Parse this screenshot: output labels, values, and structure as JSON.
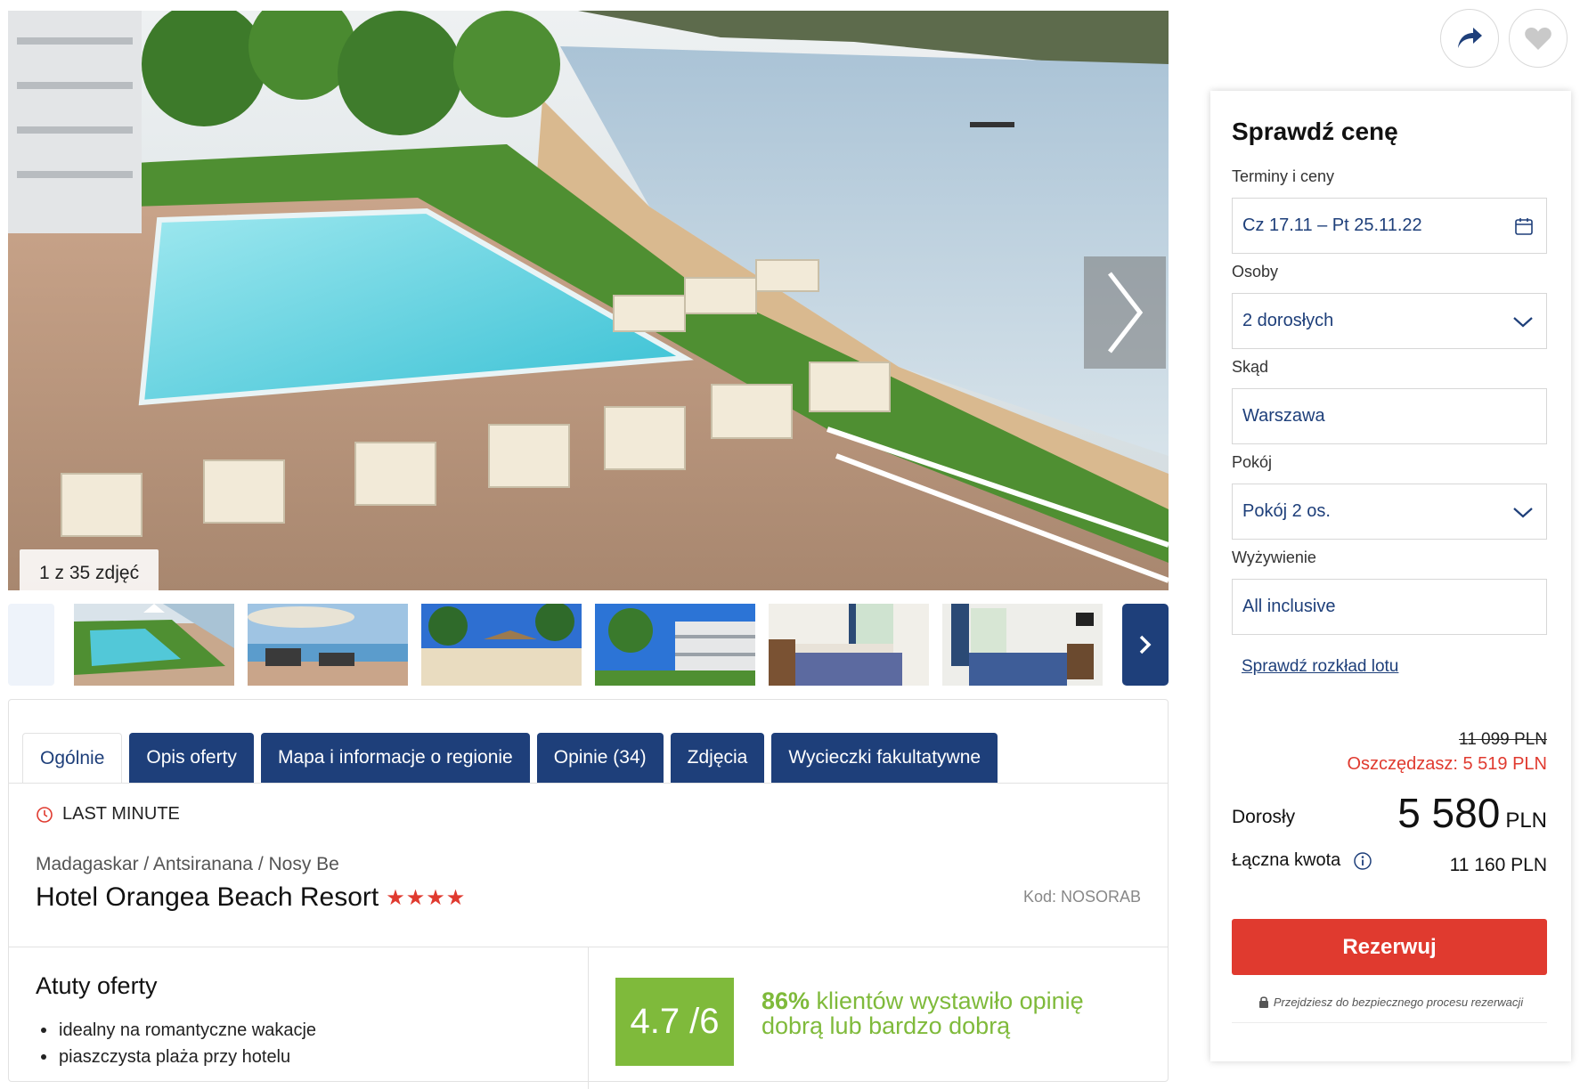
{
  "gallery": {
    "counter": "1 z 35 zdjęć",
    "next_icon": "chevron-right-icon",
    "thumbs_next_icon": "chevron-right-icon"
  },
  "tabs": [
    {
      "label": "Ogólnie",
      "active": true
    },
    {
      "label": "Opis oferty",
      "active": false
    },
    {
      "label": "Mapa i informacje o regionie",
      "active": false
    },
    {
      "label": "Opinie (34)",
      "active": false
    },
    {
      "label": "Zdjęcia",
      "active": false
    },
    {
      "label": "Wycieczki fakultatywne",
      "active": false
    }
  ],
  "offer": {
    "badge": "LAST MINUTE",
    "badge_icon": "clock-icon",
    "breadcrumb": "Madagaskar / Antsiranana / Nosy Be",
    "hotel_name": "Hotel Orangea Beach Resort",
    "stars": "★★★★",
    "star_count": 4,
    "code": "Kod: NOSORAB"
  },
  "perks": {
    "title": "Atuty oferty",
    "items": [
      "idealny na romantyczne wakacje",
      "piaszczysta plaża przy hotelu"
    ]
  },
  "rating": {
    "score": "4.7 /6",
    "percent": "86%",
    "text": " klientów wystawiło opinię dobrą lub bardzo dobrą"
  },
  "actions": {
    "share_icon": "share-arrow-icon",
    "favorite_icon": "heart-icon"
  },
  "price_card": {
    "title": "Sprawdź cenę",
    "dates_label": "Terminy i ceny",
    "dates_value": "Cz 17.11 – Pt 25.11.22",
    "persons_label": "Osoby",
    "persons_value": "2 dorosłych",
    "from_label": "Skąd",
    "from_value": "Warszawa",
    "room_label": "Pokój",
    "room_value": "Pokój 2 os.",
    "board_label": "Wyżywienie",
    "board_value": "All inclusive",
    "flight_link": "Sprawdź rozkład lotu",
    "old_price": "11 099 PLN",
    "savings": "Oszczędzasz: 5 519 PLN",
    "adult_label": "Dorosły",
    "adult_amount": "5 580",
    "adult_currency": "PLN",
    "total_label": "Łączna kwota",
    "total_value": "11 160 PLN",
    "book_label": "Rezerwuj",
    "secure_note": "Przejdziesz do bezpiecznego procesu rezerwacji"
  },
  "colors": {
    "navy": "#1e3f7a",
    "red": "#e03a2f",
    "green": "#7fba3b"
  }
}
